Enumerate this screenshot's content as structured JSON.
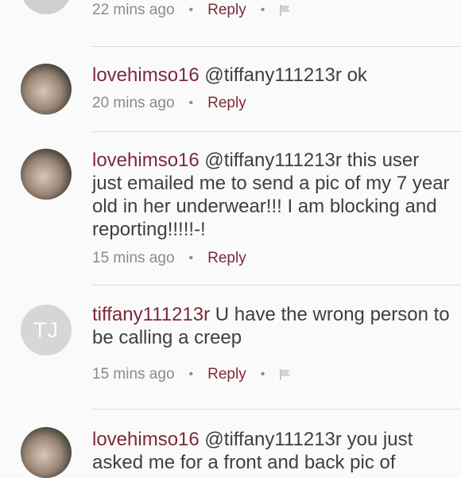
{
  "comments": [
    {
      "time": "22 mins ago",
      "reply": "Reply"
    },
    {
      "user": "lovehimso16",
      "text": " @tiffany111213r ok",
      "time": "20 mins ago",
      "reply": "Reply"
    },
    {
      "user": "lovehimso16",
      "text": " @tiffany111213r this user just emailed me to send a pic of my 7 year old in her underwear!!! I am blocking and reporting!!!!!-!",
      "time": "15 mins ago",
      "reply": "Reply"
    },
    {
      "user": "tiffany111213r",
      "initials": "TJ",
      "text": " U have the wrong person to be calling a creep",
      "time": "15 mins ago",
      "reply": "Reply"
    },
    {
      "user": "lovehimso16",
      "text": " @tiffany111213r you just asked me for a front and back pic of"
    }
  ],
  "colors": {
    "username": "#7c2a3a",
    "reply": "#7c2a3a",
    "meta": "#8a8a8a",
    "text": "#3f3f3f",
    "background": "#fafafa"
  },
  "icons": [
    "flag-icon"
  ]
}
